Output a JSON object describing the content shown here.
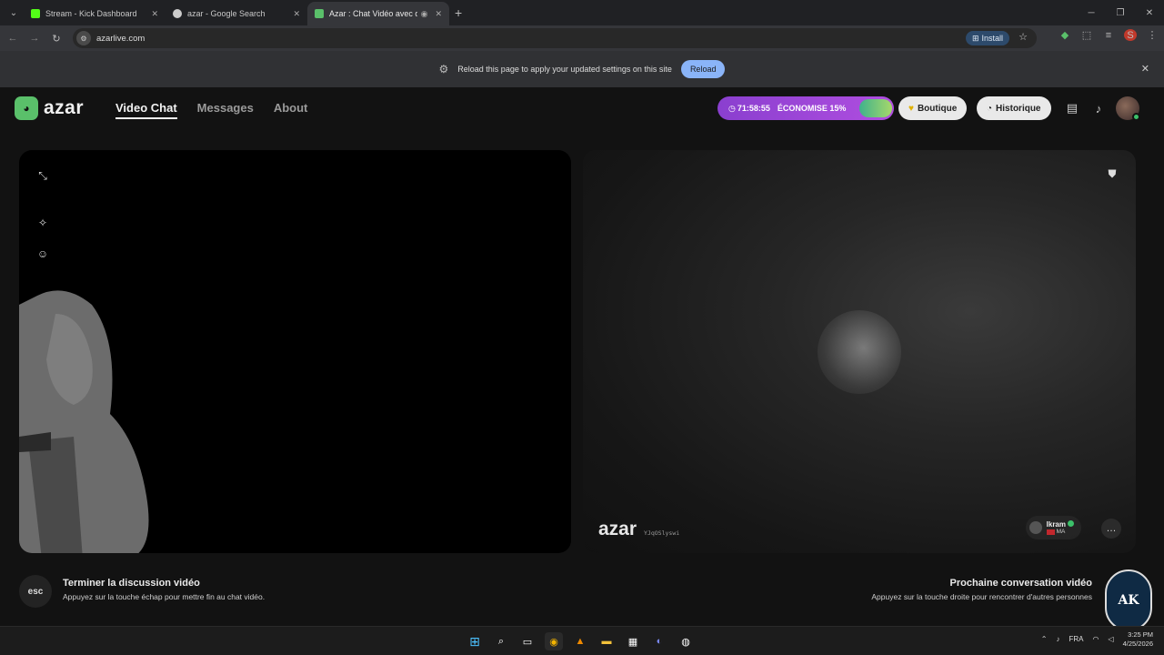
{
  "browser": {
    "tabs": [
      {
        "title": "Stream - Kick Dashboard",
        "favicon_color": "#53fc18",
        "active": false
      },
      {
        "title": "azar - Google Search",
        "favicon_color": "#cccccc",
        "active": false
      },
      {
        "title": "Azar : Chat Vidéo avec de n",
        "favicon_color": "#5ac06a",
        "active": true
      }
    ],
    "url": "azarlive.com",
    "install_label": "Install",
    "profile_initial": "S"
  },
  "infobar": {
    "message": "Reload this page to apply your updated settings on this site",
    "reload_label": "Reload"
  },
  "site": {
    "logo_text": "azar",
    "nav": [
      {
        "label": "Video Chat",
        "active": true
      },
      {
        "label": "Messages",
        "active": false
      },
      {
        "label": "About",
        "active": false
      }
    ],
    "promo": {
      "timer": "71:58:55",
      "text": "ÉCONOMISE 15%"
    },
    "boutique_label": "Boutique",
    "historique_label": "Historique",
    "accent_color": "#5ac06a",
    "promo_color": "#9b45d8"
  },
  "peer": {
    "watermark": "azar",
    "watermark_id": "YJqOSlyswi",
    "name": "Ikram",
    "country": "MA"
  },
  "hints": {
    "esc_key": "esc",
    "left_title": "Terminer la discussion vidéo",
    "left_sub": "Appuyez sur la touche échap pour mettre fin au chat vidéo.",
    "right_title": "Prochaine conversation vidéo",
    "right_sub": "Appuyez sur la touche droite pour rencontrer d'autres personnes"
  },
  "badge": {
    "text": "AK"
  },
  "taskbar": {
    "lang": "FRA",
    "time": "3:25 PM",
    "date": "4/25/2026"
  }
}
